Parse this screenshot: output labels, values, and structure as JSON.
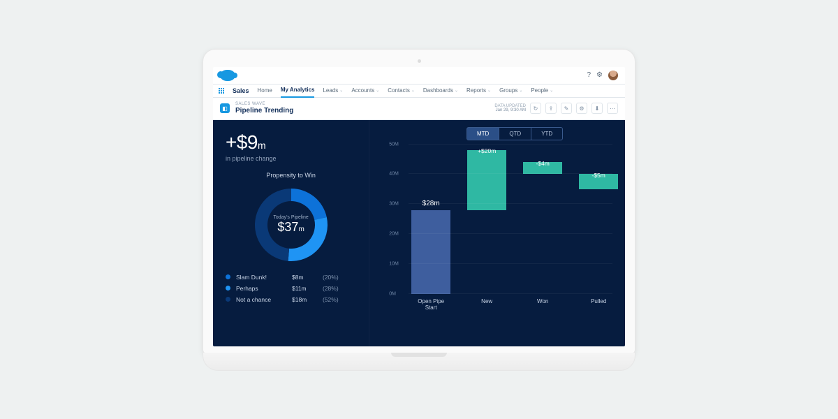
{
  "header": {
    "help_icon": "?",
    "settings_icon": "⚙"
  },
  "nav": {
    "app": "Sales",
    "tabs": [
      {
        "label": "Home",
        "dropdown": false,
        "active": false
      },
      {
        "label": "My Analytics",
        "dropdown": false,
        "active": true
      },
      {
        "label": "Leads",
        "dropdown": true,
        "active": false
      },
      {
        "label": "Accounts",
        "dropdown": true,
        "active": false
      },
      {
        "label": "Contacts",
        "dropdown": true,
        "active": false
      },
      {
        "label": "Dashboards",
        "dropdown": true,
        "active": false
      },
      {
        "label": "Reports",
        "dropdown": true,
        "active": false
      },
      {
        "label": "Groups",
        "dropdown": true,
        "active": false
      },
      {
        "label": "People",
        "dropdown": true,
        "active": false
      }
    ]
  },
  "dash": {
    "kicker": "SALES WAVE",
    "title": "Pipeline Trending",
    "updated_label": "DATA UPDATED",
    "updated_value": "Jan 29, 9:30 AM",
    "action_icons": [
      "↻",
      "⇪",
      "✎",
      "⚙",
      "⬇",
      "⋯"
    ]
  },
  "metric": {
    "value": "+$9",
    "unit": "m",
    "subtitle": "in pipeline change"
  },
  "propensity": {
    "title": "Propensity to Win",
    "center_label": "Today's Pipeline",
    "center_value": "$37",
    "center_unit": "m",
    "legend": [
      {
        "color": "#0d72d9",
        "name": "Slam Dunk!",
        "amount": "$8m",
        "pct": "(20%)"
      },
      {
        "color": "#1f94f4",
        "name": "Perhaps",
        "amount": "$11m",
        "pct": "(28%)"
      },
      {
        "color": "#0a3977",
        "name": "Not a chance",
        "amount": "$18m",
        "pct": "(52%)"
      }
    ]
  },
  "timeTabs": [
    {
      "label": "MTD",
      "active": true
    },
    {
      "label": "QTD",
      "active": false
    },
    {
      "label": "YTD",
      "active": false
    }
  ],
  "waterfall": {
    "ylabel_unit": "M",
    "yticks": [
      0,
      10,
      20,
      30,
      40,
      50
    ],
    "categories": [
      "Open Pipe Start",
      "New",
      "Won",
      "Pulled"
    ],
    "bars": [
      {
        "color": "#3e5e9e",
        "start": 0,
        "end": 28,
        "label": "$28m",
        "delta": null
      },
      {
        "color": "#2fb8a3",
        "start": 28,
        "end": 48,
        "label": null,
        "delta": "+$20m"
      },
      {
        "color": "#2fb8a3",
        "start": 40,
        "end": 44,
        "label": null,
        "delta": "-$4m"
      },
      {
        "color": "#2fb8a3",
        "start": 35,
        "end": 40,
        "label": null,
        "delta": "-$5m"
      }
    ]
  },
  "chart_data": [
    {
      "type": "pie",
      "title": "Propensity to Win",
      "center_label": "Today's Pipeline $37m",
      "series": [
        {
          "name": "Slam Dunk!",
          "value": 8,
          "pct": 20,
          "color": "#0d72d9"
        },
        {
          "name": "Perhaps",
          "value": 11,
          "pct": 28,
          "color": "#1f94f4"
        },
        {
          "name": "Not a chance",
          "value": 18,
          "pct": 52,
          "color": "#0a3977"
        }
      ],
      "unit": "$m"
    },
    {
      "type": "bar",
      "subtype": "waterfall",
      "title": "Pipeline Trending (MTD)",
      "ylabel": "$M",
      "ylim": [
        0,
        50
      ],
      "categories": [
        "Open Pipe Start",
        "New",
        "Won",
        "Pulled"
      ],
      "values": [
        28,
        20,
        -4,
        -5
      ],
      "cumulative_after": [
        28,
        48,
        44,
        39
      ],
      "annotations": [
        "$28m",
        "+$20m",
        "-$4m",
        "-$5m"
      ]
    }
  ]
}
